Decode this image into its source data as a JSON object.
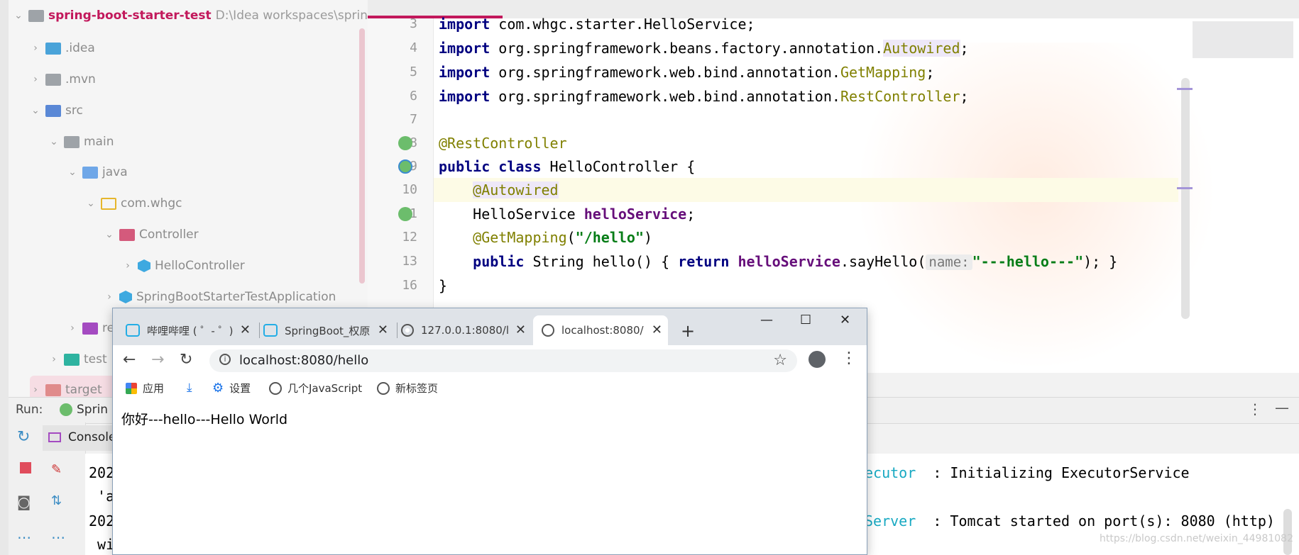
{
  "project": {
    "root_name": "spring-boot-starter-test",
    "root_path": "D:\\Idea workspaces\\spring-bo",
    "items": [
      {
        "label": ".idea"
      },
      {
        "label": ".mvn"
      },
      {
        "label": "src"
      },
      {
        "label": "main"
      },
      {
        "label": "java"
      },
      {
        "label": "com.whgc"
      },
      {
        "label": "Controller"
      },
      {
        "label": "HelloController"
      },
      {
        "label": "SpringBootStarterTestApplication"
      },
      {
        "label": "re"
      },
      {
        "label": "test"
      },
      {
        "label": "target"
      }
    ]
  },
  "editor": {
    "line_numbers": [
      "3",
      "4",
      "5",
      "6",
      "7",
      "8",
      "9",
      "10",
      "11",
      "12",
      "13",
      "16"
    ],
    "lines": {
      "l3_kw": "import",
      "l3_rest": " com.whgc.starter.HelloService;",
      "l4_kw": "import",
      "l4_pkg": " org.springframework.beans.factory.annotation.",
      "l4_cls": "Autowired",
      "l4_end": ";",
      "l5_kw": "import",
      "l5_pkg": " org.springframework.web.bind.annotation.",
      "l5_cls": "GetMapping",
      "l5_end": ";",
      "l6_kw": "import",
      "l6_pkg": " org.springframework.web.bind.annotation.",
      "l6_cls": "RestController",
      "l6_end": ";",
      "l8_ann": "@RestController",
      "l9_kw1": "public",
      "l9_kw2": "class",
      "l9_rest": " HelloController {",
      "l10_ann": "@Autowired",
      "l11_type": "HelloService ",
      "l11_field": "helloService",
      "l11_end": ";",
      "l12_ann": "@GetMapping",
      "l12_open": "(",
      "l12_str": "\"/hello\"",
      "l12_close": ")",
      "l13_kw1": "public",
      "l13_mid": " String hello() { ",
      "l13_kw2": "return",
      "l13_sp": " ",
      "l13_field": "helloService",
      "l13_call": ".sayHello(",
      "l13_hint": "name:",
      "l13_str": "\"---hello---\"",
      "l13_end": "); }",
      "l16": "}"
    }
  },
  "run": {
    "label": "Run:",
    "config_name": "Sprin",
    "console_tab": "Console",
    "log_line1_prefix": "202",
    "log_line1_class": "ecutor",
    "log_line1_msg": "  : Initializing ExecutorService",
    "log_line1b": " 'a",
    "log_line2_prefix": "202",
    "log_line2_class": "Server",
    "log_line2_msg": "  : Tomcat started on port(s): 8080 (http)",
    "log_line2b": " wi"
  },
  "browser": {
    "tabs": [
      {
        "title": "哔哩哔哩 ( ゜- ゜)"
      },
      {
        "title": "SpringBoot_权原"
      },
      {
        "title": "127.0.0.1:8080/l"
      },
      {
        "title": "localhost:8080/"
      }
    ],
    "new_tab": "+",
    "url": "localhost:8080/hello",
    "bookmarks": [
      {
        "label": "应用"
      },
      {
        "label": ""
      },
      {
        "label": "设置"
      },
      {
        "label": "几个JavaScript"
      },
      {
        "label": "新标签页"
      }
    ],
    "page_text": "你好---hello---Hello World"
  },
  "watermark": "https://blog.csdn.net/weixin_44981082",
  "colors": {
    "accent": "#c2185b",
    "keyword": "#000080",
    "annotation": "#808000",
    "string": "#067d17",
    "field": "#660e7a"
  }
}
